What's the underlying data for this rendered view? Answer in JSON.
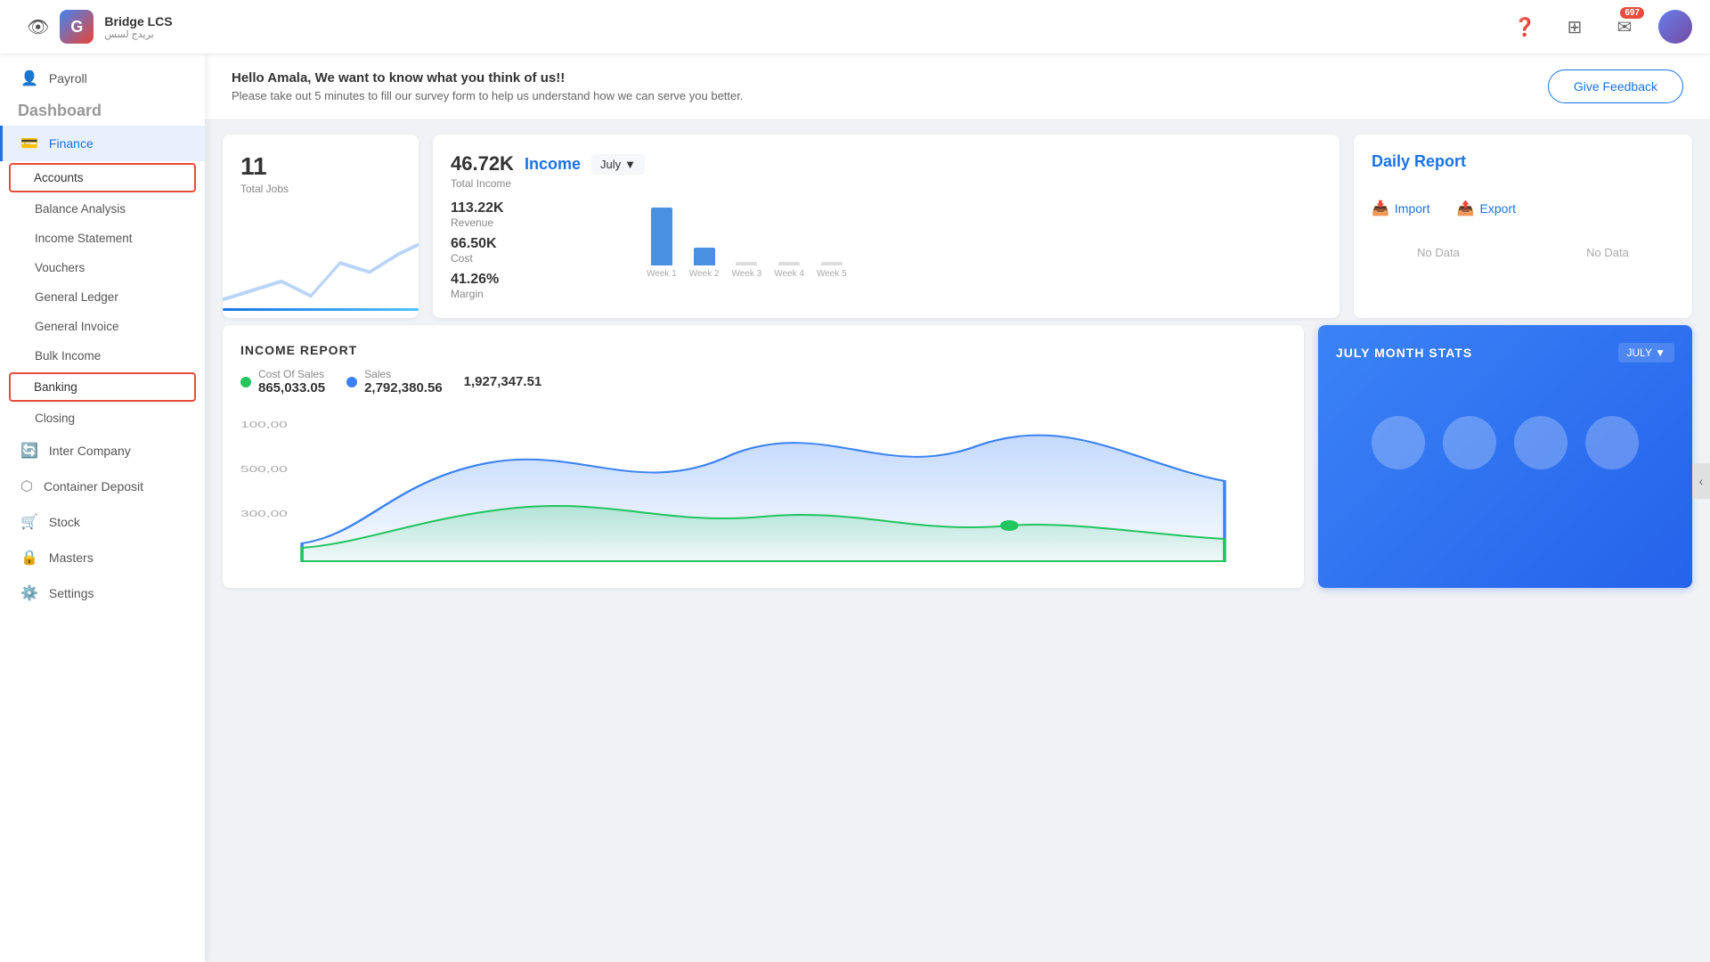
{
  "app": {
    "name": "Bridge LCS",
    "arabic": "بريدج لسس",
    "logo_letter": "G"
  },
  "topbar": {
    "notification_count": "697"
  },
  "sidebar": {
    "sections": [
      {
        "id": "payroll",
        "label": "Payroll",
        "icon": "👤",
        "active": false
      },
      {
        "id": "finance",
        "label": "Finance",
        "icon": "💳",
        "active": true
      }
    ],
    "finance_items": [
      {
        "id": "accounts",
        "label": "Accounts",
        "highlighted": true
      },
      {
        "id": "balance-analysis",
        "label": "Balance Analysis",
        "highlighted": false
      },
      {
        "id": "income-statement",
        "label": "Income Statement",
        "highlighted": false
      },
      {
        "id": "vouchers",
        "label": "Vouchers",
        "highlighted": false
      },
      {
        "id": "general-ledger",
        "label": "General Ledger",
        "highlighted": false
      },
      {
        "id": "general-invoice",
        "label": "General Invoice",
        "highlighted": false
      },
      {
        "id": "bulk-income",
        "label": "Bulk Income",
        "highlighted": false
      },
      {
        "id": "banking",
        "label": "Banking",
        "highlighted": true
      },
      {
        "id": "closing",
        "label": "Closing",
        "highlighted": false
      }
    ],
    "other_items": [
      {
        "id": "inter-company",
        "label": "Inter Company",
        "icon": "🔄"
      },
      {
        "id": "container-deposit",
        "label": "Container Deposit",
        "icon": "⬡"
      },
      {
        "id": "stock",
        "label": "Stock",
        "icon": "🛒"
      },
      {
        "id": "masters",
        "label": "Masters",
        "icon": "🔒"
      },
      {
        "id": "settings",
        "label": "Settings",
        "icon": "⚙️"
      }
    ]
  },
  "feedback": {
    "title": "Hello Amala, We want to know what you think of us!!",
    "subtitle": "Please take out 5 minutes to fill our survey form to help us understand how we can serve you better.",
    "button": "Give Feedback"
  },
  "page_title": "Dashboard",
  "jobs": {
    "count": "11",
    "label": "Total Jobs"
  },
  "income": {
    "title": "Income",
    "month": "July",
    "revenue_val": "113.22K",
    "revenue_label": "Revenue",
    "cost_val": "66.50K",
    "cost_label": "Cost",
    "margin_val": "41.26%",
    "margin_label": "Margin",
    "total_val": "46.72K",
    "total_label": "Total Income",
    "bars": [
      {
        "week": "Week 1",
        "height": 65
      },
      {
        "week": "Week 2",
        "height": 18
      },
      {
        "week": "Week 3",
        "height": 0
      },
      {
        "week": "Week 4",
        "height": 0
      },
      {
        "week": "Week 5",
        "height": 0
      }
    ]
  },
  "daily_report": {
    "title": "Daily Report",
    "import_label": "Import",
    "export_label": "Export",
    "no_data": "No Data"
  },
  "income_report": {
    "title": "INCOME REPORT",
    "cost_of_sales_label": "Cost Of Sales",
    "cost_of_sales_val": "865,033.05",
    "sales_label": "Sales",
    "sales_val": "2,792,380.56",
    "total_val": "1,927,347.51"
  },
  "july_stats": {
    "title": "JULY MONTH STATS",
    "month_selector": "JULY"
  }
}
